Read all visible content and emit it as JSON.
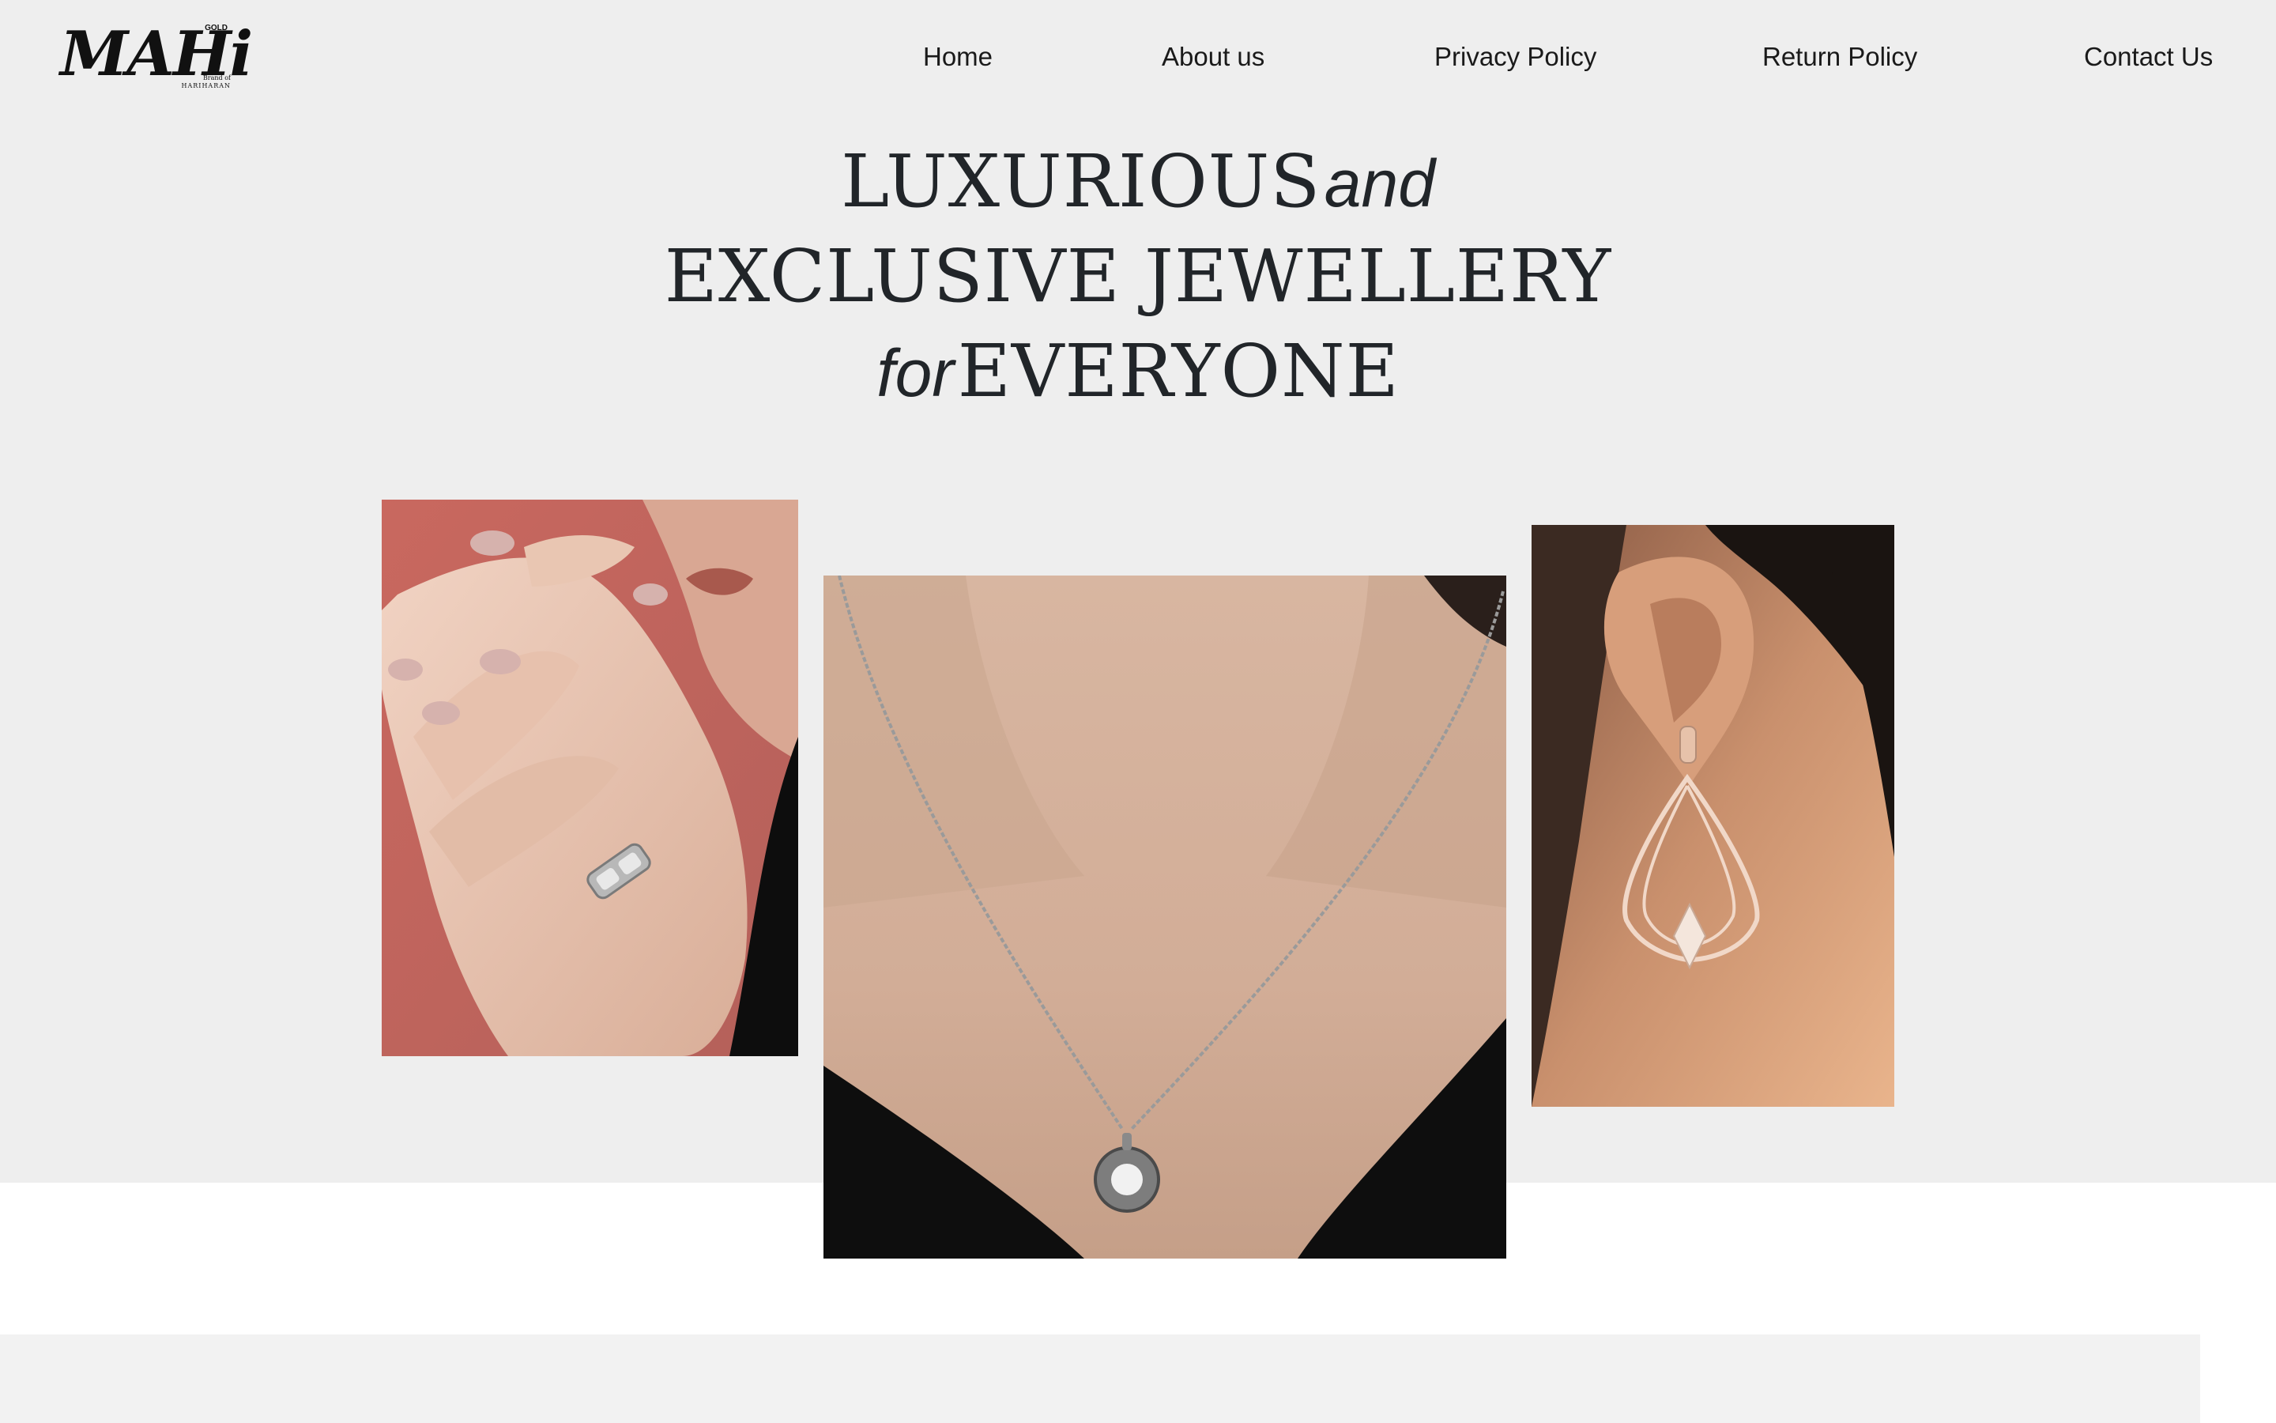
{
  "brand": {
    "logo_text": "MAHi",
    "logo_tag": "GOLD",
    "logo_sub1": "Brand of",
    "logo_sub2": "HARIHARAN"
  },
  "nav": {
    "items": [
      {
        "label": "Home"
      },
      {
        "label": "About us"
      },
      {
        "label": "Privacy Policy"
      },
      {
        "label": "Return Policy"
      },
      {
        "label": "Contact Us"
      }
    ]
  },
  "hero": {
    "line1_caps": "LUXURIOUS",
    "line1_ital": "and",
    "line2_caps": "EXCLUSIVE JEWELLERY",
    "line3_ital": "for",
    "line3_caps": "EVERYONE"
  },
  "images": {
    "ring": "ring-on-hand-photo",
    "necklace": "pendant-necklace-photo",
    "earring": "drop-earring-photo"
  },
  "colors": {
    "hero_bg": "#eeeeee",
    "text": "#212529",
    "page_bg": "#ffffff"
  }
}
